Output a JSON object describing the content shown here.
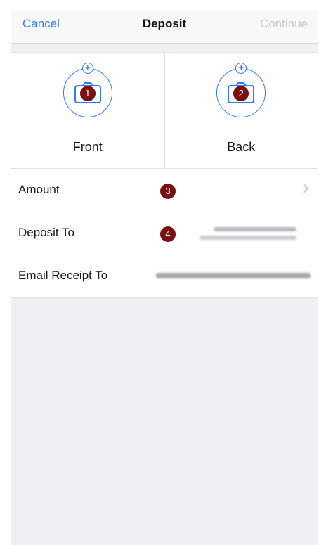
{
  "nav": {
    "cancel": "Cancel",
    "title": "Deposit",
    "continue": "Continue"
  },
  "capture": {
    "front": {
      "label": "Front",
      "badge": "1",
      "icon": "camera-icon"
    },
    "back": {
      "label": "Back",
      "badge": "2",
      "icon": "camera-icon"
    }
  },
  "rows": {
    "amount": {
      "label": "Amount",
      "badge": "3"
    },
    "deposit_to": {
      "label": "Deposit To",
      "badge": "4"
    },
    "email_receipt": {
      "label": "Email Receipt To"
    }
  },
  "colors": {
    "accent": "#2f7df6",
    "badge": "#7a1010",
    "disabled": "#c8c8cc"
  }
}
